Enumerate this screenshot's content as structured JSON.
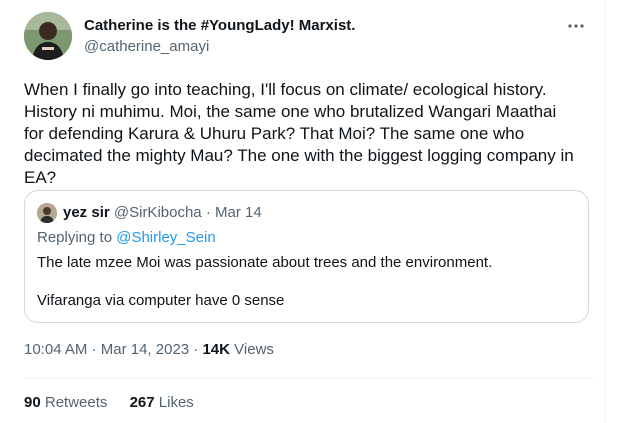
{
  "tweet": {
    "display_name": "Catherine is the #YoungLady! Marxist.",
    "handle": "@catherine_amayi",
    "text": "When I finally go into teaching, I'll focus on climate/ ecological history.\nHistory ni muhimu. Moi, the same one who brutalized Wangari Maathai\nfor defending Karura & Uhuru Park? That Moi? The same one who\ndecimated the mighty Mau? The one with the biggest logging company in\nEA?",
    "more_icon": "more-horizontal-icon",
    "time": "10:04 AM",
    "separator": "·",
    "date": "Mar 14, 2023",
    "separator2": "·",
    "views_count": "14K",
    "views_label": "Views"
  },
  "quoted": {
    "display_name": "yez sir",
    "handle": "@SirKibocha",
    "separator": "·",
    "date": "Mar 14",
    "replying_prefix": "Replying to ",
    "replying_to": "@Shirley_Sein",
    "text_line1": "The late mzee Moi was passionate about trees and the environment.",
    "text_line2": "Vifaranga via computer have 0 sense"
  },
  "stats": {
    "retweets_count": "90",
    "retweets_label": "Retweets",
    "likes_count": "267",
    "likes_label": "Likes"
  },
  "colors": {
    "text": "#0f1419",
    "secondary": "#536471",
    "link": "#1d9bf0",
    "border": "#cfd9de"
  }
}
